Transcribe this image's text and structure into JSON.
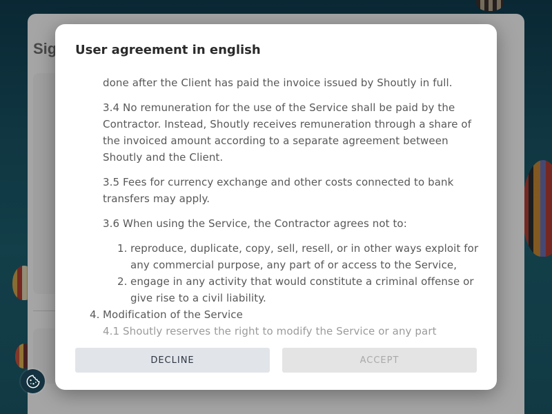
{
  "background_page": {
    "title_partial": "Sig"
  },
  "modal": {
    "title": "User agreement in english",
    "body": {
      "cut_top_line": "done after the Client has paid the invoice issued by Shoutly in full.",
      "p_3_4": "3.4 No remuneration for the use of the Service shall be paid by the Contractor. Instead, Shoutly receives remuneration through a share of the invoiced amount according to a separate agreement between Shoutly and the Client.",
      "p_3_5": "3.5 Fees for currency exchange and other costs connected to bank transfers may apply.",
      "p_3_6": "3.6 When using the Service, the Contractor agrees not to:",
      "list_3_6": [
        {
          "num": "1.",
          "text": "reproduce, duplicate, copy, sell, resell, or in other ways exploit for any commercial purpose, any part of or access to the Service,"
        },
        {
          "num": "2.",
          "text": "engage in any activity that would constitute a criminal offense or give rise to a civil liability."
        }
      ],
      "section_4": {
        "num": "4.",
        "text": "Modification of the Service"
      },
      "cut_bottom_line": "4.1 Shoutly reserves the right to modify the Service or any part"
    },
    "buttons": {
      "decline": "DECLINE",
      "accept": "ACCEPT"
    }
  },
  "cookie_button": {
    "icon": "cookie-icon"
  },
  "colors": {
    "decline_bg": "#e1e5ea",
    "accept_bg_disabled": "#e4e4e4",
    "cookie_btn_bg": "#14323f"
  }
}
